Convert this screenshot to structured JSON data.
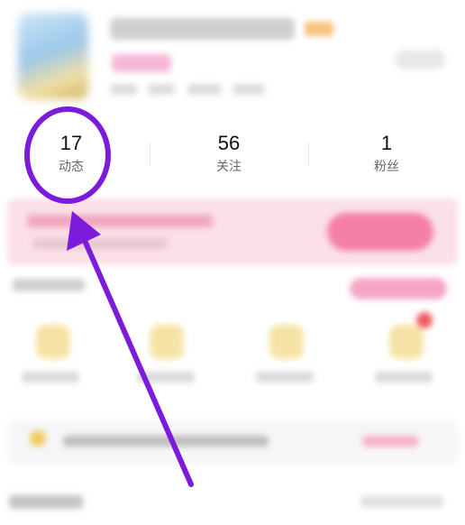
{
  "profile": {
    "avatar_icon": "user-avatar",
    "edit_icon": "chevron-right-icon"
  },
  "stats": [
    {
      "value": "17",
      "label": "动态"
    },
    {
      "value": "56",
      "label": "关注"
    },
    {
      "value": "1",
      "label": "粉丝"
    }
  ],
  "annotation": {
    "color": "#7c1bd9",
    "target": "stats.0"
  },
  "colors": {
    "banner_bg": "#fbe0e8",
    "banner_button": "#f57fa5",
    "notification_dot": "#ee5a5a"
  }
}
